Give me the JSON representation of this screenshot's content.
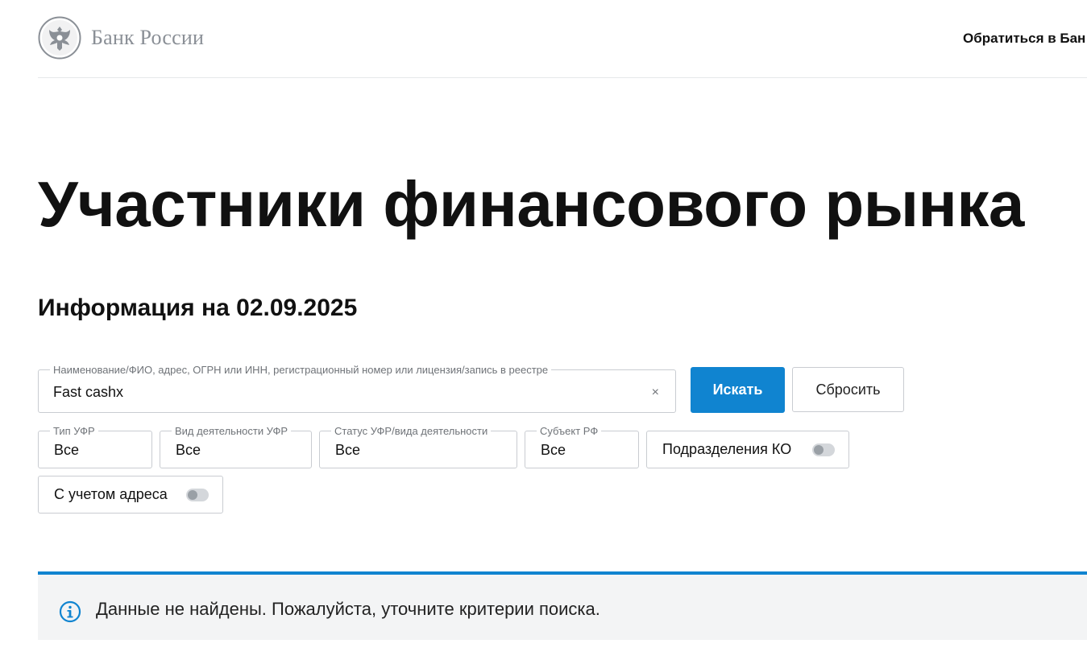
{
  "header": {
    "logo_text": "Банк России",
    "contact_link": "Обратиться в Бан"
  },
  "page": {
    "title": "Участники финансового рынка",
    "info_date": "Информация на 02.09.2025"
  },
  "search": {
    "label": "Наименование/ФИО, адрес, ОГРН или ИНН, регистрационный номер или лицензия/запись в реестре",
    "value": "Fast cashx",
    "clear_label": "×",
    "submit_label": "Искать",
    "reset_label": "Сбросить"
  },
  "filters": {
    "type": {
      "label": "Тип УФР",
      "value": "Все"
    },
    "activity": {
      "label": "Вид деятельности УФР",
      "value": "Все"
    },
    "status": {
      "label": "Статус УФР/вида деятельности",
      "value": "Все"
    },
    "region": {
      "label": "Субъект РФ",
      "value": "Все"
    },
    "branches_toggle": {
      "label": "Подразделения КО",
      "checked": false
    },
    "address_toggle": {
      "label": "С учетом адреса",
      "checked": false
    }
  },
  "notice": {
    "icon": "info-icon",
    "text": "Данные не найдены. Пожалуйста, уточните критерии поиска."
  },
  "colors": {
    "accent": "#1084d0",
    "notice_bg": "#f3f4f5",
    "logo_gray": "#8a8f96"
  }
}
